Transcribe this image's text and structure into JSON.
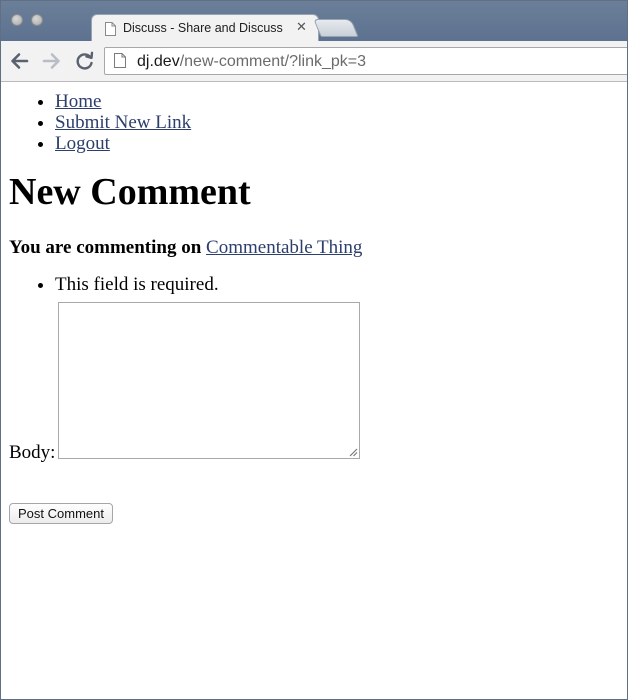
{
  "browser": {
    "tab_title": "Discuss - Share and Discuss",
    "url_host": "dj.dev",
    "url_path": "/new-comment/?link_pk=3"
  },
  "nav": {
    "items": [
      {
        "label": "Home"
      },
      {
        "label": "Submit New Link"
      },
      {
        "label": "Logout"
      }
    ]
  },
  "page": {
    "heading": "New Comment",
    "context_prefix": "You are commenting on",
    "context_link": "Commentable Thing",
    "errors": [
      "This field is required."
    ],
    "body_label": "Body:",
    "body_value": "",
    "submit_label": "Post Comment"
  },
  "colors": {
    "link": "#2c3e6b",
    "tabstrip": "#6b7f99",
    "toolbar": "#f2f2f2"
  },
  "icons": {
    "tab_favicon": "page-icon",
    "tab_close": "close-icon",
    "back": "back-arrow-icon",
    "forward": "forward-arrow-icon",
    "reload": "reload-icon",
    "omnibox_page": "page-icon"
  }
}
